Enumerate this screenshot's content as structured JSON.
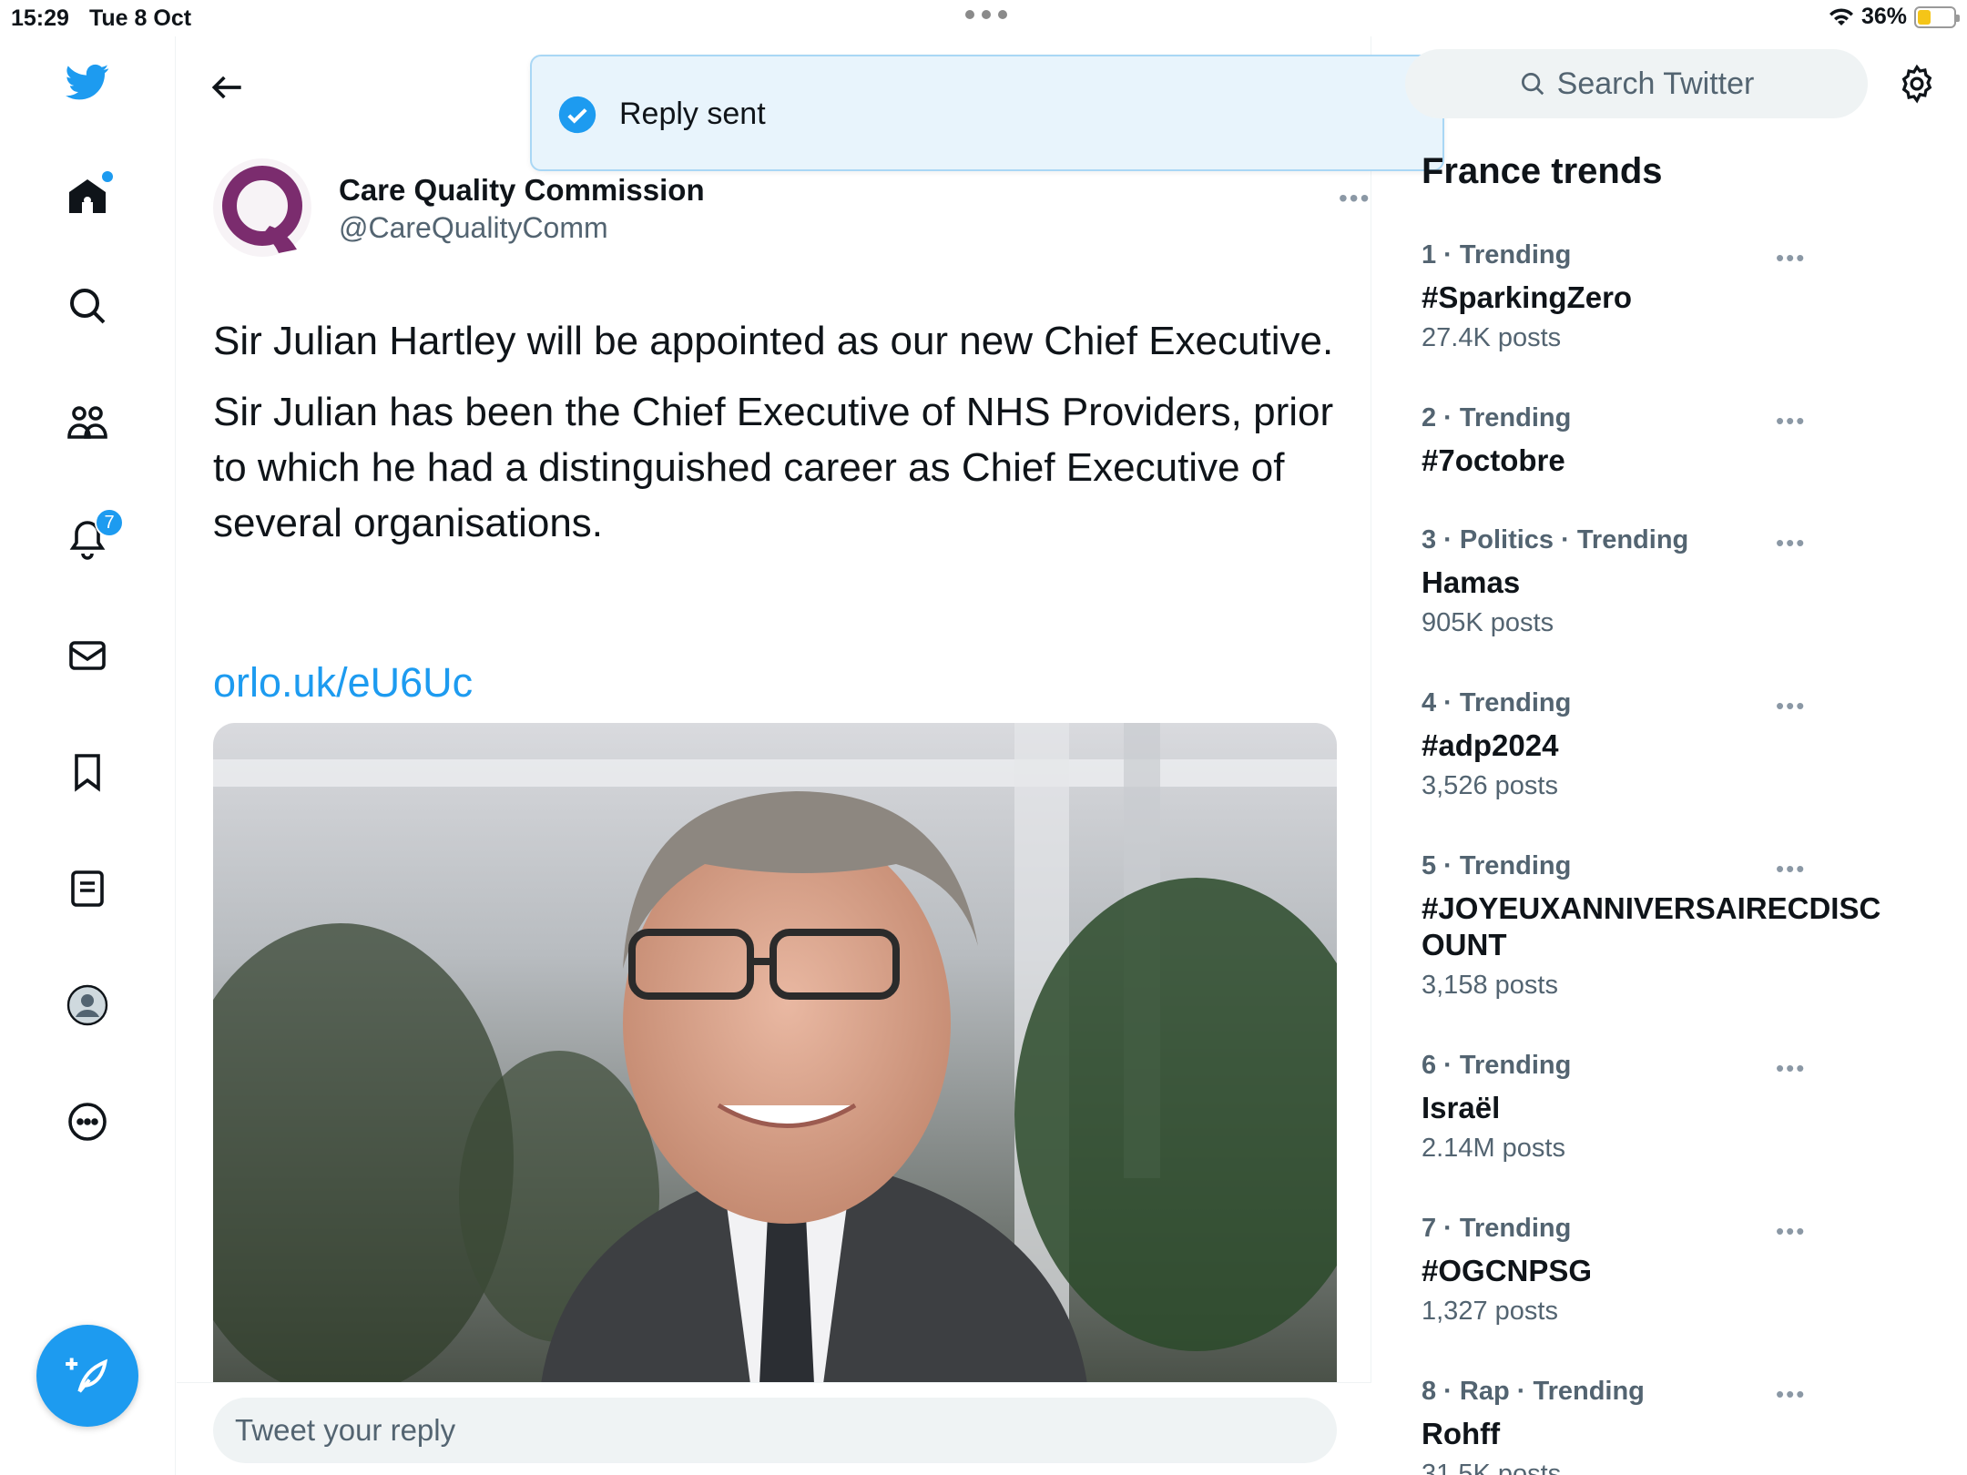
{
  "status_bar": {
    "time": "15:29",
    "date": "Tue 8 Oct",
    "battery": "36%"
  },
  "colors": {
    "accent": "#1d9bf0",
    "brand_purple": "#7b2c6e",
    "text": "#0f1419",
    "secondary": "#536471"
  },
  "nav": {
    "items": [
      {
        "icon": "twitter-bird-icon"
      },
      {
        "icon": "home-icon"
      },
      {
        "icon": "search-icon"
      },
      {
        "icon": "communities-icon"
      },
      {
        "icon": "notifications-icon",
        "badge": "7"
      },
      {
        "icon": "messages-icon"
      },
      {
        "icon": "bookmarks-icon"
      },
      {
        "icon": "lists-icon"
      },
      {
        "icon": "profile-icon"
      },
      {
        "icon": "more-icon"
      }
    ],
    "compose_icon": "compose-tweet-icon"
  },
  "toast": {
    "text": "Reply sent"
  },
  "tweet": {
    "author_name": "Care Quality Commission",
    "author_handle": "@CareQualityComm",
    "paragraphs": [
      "Sir Julian Hartley will be appointed as our new Chief Executive.",
      "Sir Julian has been the Chief Executive of NHS Providers, prior to which he had a distinguished career as Chief Executive of several organisations."
    ],
    "link": "orlo.uk/eU6Uc",
    "more_label": "•••"
  },
  "reply": {
    "placeholder": "Tweet your reply"
  },
  "search": {
    "placeholder": "Search Twitter"
  },
  "trends": {
    "title": "France trends",
    "items": [
      {
        "meta": "1 · Trending",
        "name": "#SparkingZero",
        "count": "27.4K posts"
      },
      {
        "meta": "2 · Trending",
        "name": "#7octobre",
        "count": ""
      },
      {
        "meta": "3 · Politics · Trending",
        "name": "Hamas",
        "count": "905K posts"
      },
      {
        "meta": "4 · Trending",
        "name": "#adp2024",
        "count": "3,526 posts"
      },
      {
        "meta": "5 · Trending",
        "name": "#JOYEUXANNIVERSAIRECDISCOUNT",
        "count": "3,158 posts"
      },
      {
        "meta": "6 · Trending",
        "name": "Israël",
        "count": "2.14M posts"
      },
      {
        "meta": "7 · Trending",
        "name": "#OGCNPSG",
        "count": "1,327 posts"
      },
      {
        "meta": "8 · Rap · Trending",
        "name": "Rohff",
        "count": "31.5K posts"
      }
    ]
  }
}
